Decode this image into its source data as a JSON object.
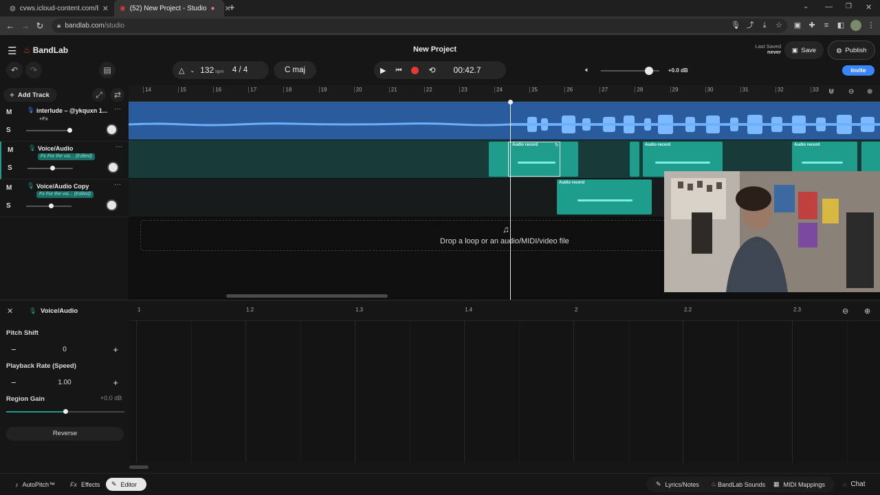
{
  "browser": {
    "tabs": [
      {
        "title": "cvws.icloud-content.com/B/ATD",
        "active": false
      },
      {
        "title": "(52) New Project - Studio",
        "active": true
      }
    ],
    "url_host": "bandlab.com",
    "url_path": "/studio"
  },
  "header": {
    "brand": "BandLab",
    "project_title": "New Project",
    "last_saved_label": "Last Saved",
    "last_saved_value": "never",
    "save_label": "Save",
    "publish_label": "Publish",
    "invite_label": "Invite",
    "bpm": "132",
    "bpm_unit": "bpm",
    "time_signature": "4 / 4",
    "key": "C maj",
    "time": "00:42.7",
    "volume_db": "+0.0 dB",
    "volume_level": 0.82
  },
  "tracks_panel": {
    "add_track_label": "Add Track",
    "mute_label": "M",
    "solo_label": "S",
    "tracks": [
      {
        "name": "interlude – @ykquxn 1...",
        "fx": "+Fx",
        "volume": 0.95
      },
      {
        "name": "Voice/Audio",
        "fx": "Fx For the voi... (Edited)",
        "volume": 0.55
      },
      {
        "name": "Voice/Audio Copy",
        "fx": "Fx For the voi... (Edited)",
        "volume": 0.55
      }
    ]
  },
  "ruler": {
    "bars": [
      "14",
      "15",
      "16",
      "17",
      "18",
      "19",
      "20",
      "21",
      "22",
      "23",
      "24",
      "25",
      "26",
      "27",
      "28",
      "29",
      "30",
      "31",
      "32",
      "33"
    ]
  },
  "regions": {
    "audio_label": "Audio record"
  },
  "drop_text": "Drop a loop or an audio/MIDI/video file",
  "editor": {
    "track_name": "Voice/Audio",
    "ruler": [
      "1",
      "1.2",
      "1.3",
      "1.4",
      "2",
      "2.2",
      "2.3"
    ],
    "pitch_label": "Pitch Shift",
    "pitch_value": "0",
    "rate_label": "Playback Rate (Speed)",
    "rate_value": "1.00",
    "gain_label": "Region Gain",
    "gain_value": "+0.0 dB",
    "gain_level": 0.5,
    "reverse_label": "Reverse"
  },
  "bottom": {
    "autopitch": "AutoPitch™",
    "effects": "Effects",
    "editor": "Editor",
    "lyrics": "Lyrics/Notes",
    "sounds": "BandLab Sounds",
    "midi": "MIDI Mappings",
    "chat": "Chat"
  },
  "colors": {
    "accent_blue": "#3a86ff",
    "track1": "#2c5d9e",
    "track_teal": "#1e9c8c",
    "record": "#e53935"
  }
}
